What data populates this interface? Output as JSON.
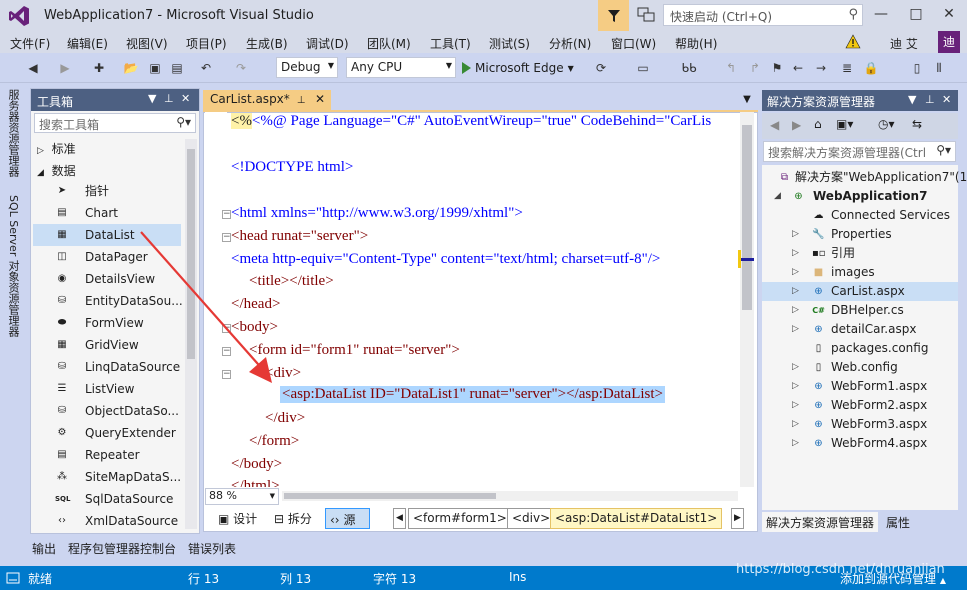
{
  "window": {
    "title": "WebApplication7 - Microsoft Visual Studio",
    "quick_launch_placeholder": "快速启动 (Ctrl+Q)",
    "user_name": "迪 艾",
    "avatar_letter": "迪"
  },
  "menu": [
    "文件(F)",
    "编辑(E)",
    "视图(V)",
    "项目(P)",
    "生成(B)",
    "调试(D)",
    "团队(M)",
    "工具(T)",
    "测试(S)",
    "分析(N)",
    "窗口(W)",
    "帮助(H)"
  ],
  "toolbar": {
    "config": "Debug",
    "platform": "Any CPU",
    "run_target": "Microsoft Edge"
  },
  "left_strip": [
    "服务器资源管理器",
    "SQL Server 对象资源管理器"
  ],
  "toolbox": {
    "title": "工具箱",
    "search_placeholder": "搜索工具箱",
    "groups": [
      "标准",
      "数据"
    ],
    "items": [
      "指针",
      "Chart",
      "DataList",
      "DataPager",
      "DetailsView",
      "EntityDataSou...",
      "FormView",
      "GridView",
      "LinqDataSource",
      "ListView",
      "ObjectDataSo...",
      "QueryExtender",
      "Repeater",
      "SiteMapDataS...",
      "SqlDataSource",
      "XmlDataSource"
    ],
    "selected": "DataList"
  },
  "editor": {
    "tab_label": "CarList.aspx*",
    "zoom": "88 %",
    "views": [
      "设计",
      "拆分",
      "源"
    ],
    "active_view": "源",
    "breadcrumbs": [
      "<form#form1>",
      "<div>",
      "<asp:DataList#DataList1>"
    ],
    "code": {
      "l1": "<%@ Page Language=\"C#\" AutoEventWireup=\"true\" CodeBehind=\"CarLis",
      "l2": "<!DOCTYPE html>",
      "l3": "<html xmlns=\"http://www.w3.org/1999/xhtml\">",
      "l4": "<head runat=\"server\">",
      "l5": "<meta http-equiv=\"Content-Type\" content=\"text/html; charset=utf-8\"/>",
      "l6": "<title></title>",
      "l7": "</head>",
      "l8": "<body>",
      "l9": "<form id=\"form1\" runat=\"server\">",
      "l10": "<div>",
      "l11": "<asp:DataList ID=\"DataList1\" runat=\"server\"></asp:DataList>",
      "l12": "</div>",
      "l13": "</form>",
      "l14": "</body>",
      "l15": "</html>"
    }
  },
  "solution_explorer": {
    "title": "解决方案资源管理器",
    "search_placeholder": "搜索解决方案资源管理器(Ctrl",
    "solution_label": "解决方案\"WebApplication7\"(1",
    "project": "WebApplication7",
    "items": [
      "Connected Services",
      "Properties",
      "引用",
      "images",
      "CarList.aspx",
      "DBHelper.cs",
      "detailCar.aspx",
      "packages.config",
      "Web.config",
      "WebForm1.aspx",
      "WebForm2.aspx",
      "WebForm3.aspx",
      "WebForm4.aspx"
    ],
    "selected": "CarList.aspx",
    "tabs": [
      "解决方案资源管理器",
      "属性"
    ]
  },
  "bottom_tabs": [
    "输出",
    "程序包管理器控制台",
    "错误列表"
  ],
  "status": {
    "ready": "就绪",
    "line": "行 13",
    "col": "列 13",
    "char": "字符 13",
    "mode": "Ins",
    "source_control": "添加到源代码管理"
  },
  "watermark": "https://blog.csdn.net/dnruanjian",
  "colors": {
    "accent": "#007acc",
    "tab_active": "#f5cc84",
    "pane_header": "#4d6082",
    "selection": "#add6ff",
    "annotation_arrow": "#e53935"
  }
}
